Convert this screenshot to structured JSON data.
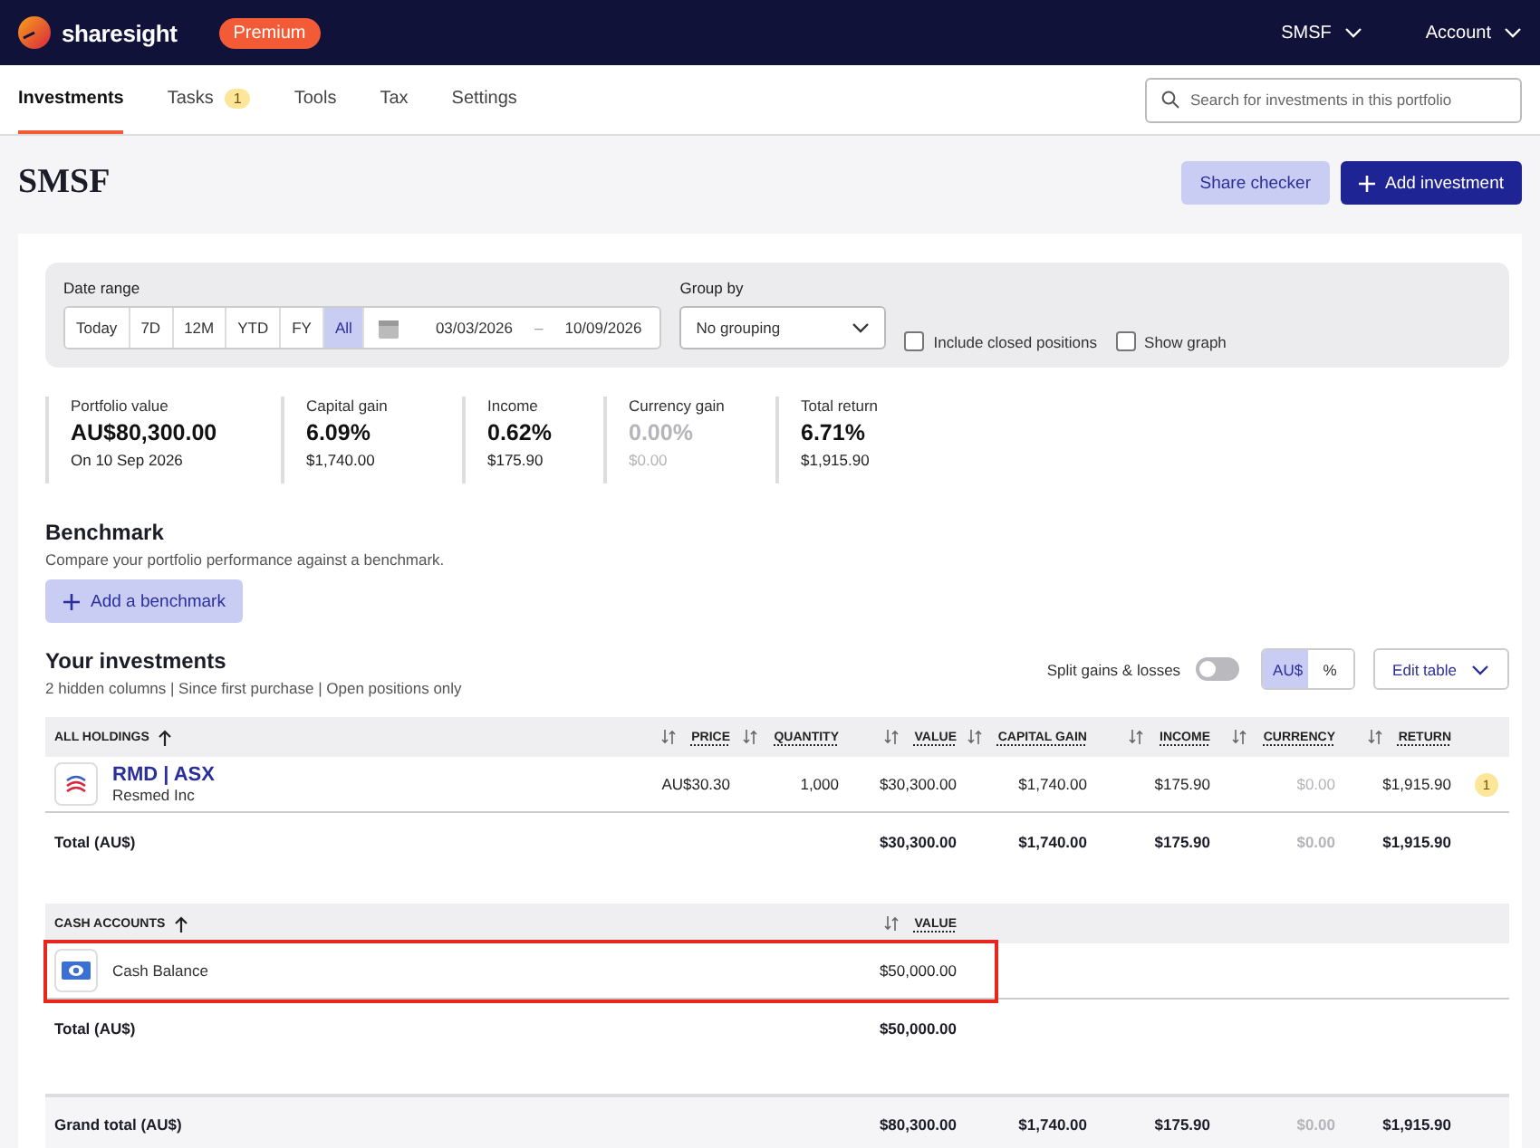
{
  "header": {
    "brand": "sharesight",
    "plan": "Premium",
    "menus": [
      {
        "label": "SMSF"
      },
      {
        "label": "Account"
      }
    ]
  },
  "tabs": [
    {
      "label": "Investments",
      "selected": true
    },
    {
      "label": "Tasks",
      "selected": false,
      "badge": "1"
    },
    {
      "label": "Tools",
      "selected": false
    },
    {
      "label": "Tax",
      "selected": false
    },
    {
      "label": "Settings",
      "selected": false
    }
  ],
  "search": {
    "placeholder": "Search for investments in this portfolio"
  },
  "portfolio": {
    "title": "SMSF",
    "buttons": [
      {
        "label": "Share checker",
        "kind": "secondary"
      },
      {
        "label": "Add investment",
        "kind": "primary"
      }
    ]
  },
  "filters": {
    "date_range_label": "Date range",
    "periods": [
      {
        "label": "Today",
        "selected": false
      },
      {
        "label": "7D",
        "selected": false
      },
      {
        "label": "12M",
        "selected": false
      },
      {
        "label": "YTD",
        "selected": false
      },
      {
        "label": "FY",
        "selected": false
      },
      {
        "label": "All",
        "selected": true
      }
    ],
    "start_date": "03/03/2026",
    "separator": "–",
    "end_date": "10/09/2026",
    "group_by_label": "Group by",
    "group_by": "No grouping",
    "checkboxes": [
      {
        "label": "Include closed positions",
        "checked": false
      },
      {
        "label": "Show graph",
        "checked": false
      }
    ]
  },
  "summary": [
    {
      "label": "Portfolio value",
      "value": "AU$80,300.00",
      "detail": "On 10 Sep 2026",
      "muted": false
    },
    {
      "label": "Capital gain",
      "value": "6.09%",
      "detail": "$1,740.00",
      "muted": false
    },
    {
      "label": "Income",
      "value": "0.62%",
      "detail": "$175.90",
      "muted": false
    },
    {
      "label": "Currency gain",
      "value": "0.00%",
      "detail": "$0.00",
      "muted": true
    },
    {
      "label": "Total return",
      "value": "6.71%",
      "detail": "$1,915.90",
      "muted": false
    }
  ],
  "benchmark": {
    "title": "Benchmark",
    "description": "Compare your portfolio performance against a benchmark.",
    "button": "Add a benchmark"
  },
  "investments": {
    "title": "Your investments",
    "subtitle": "2 hidden columns | Since first purchase | Open positions only",
    "split_label": "Split gains & losses",
    "split_on": false,
    "units": [
      {
        "label": "AU$",
        "selected": true
      },
      {
        "label": "%",
        "selected": false
      }
    ],
    "edit_button": "Edit table"
  },
  "holdings": {
    "columns": [
      {
        "label": "ALL HOLDINGS",
        "sorted": true
      },
      {
        "label": "PRICE",
        "sorted": false
      },
      {
        "label": "QUANTITY",
        "sorted": false
      },
      {
        "label": "VALUE",
        "sorted": false
      },
      {
        "label": "CAPITAL GAIN",
        "sorted": false
      },
      {
        "label": "INCOME",
        "sorted": false
      },
      {
        "label": "CURRENCY",
        "sorted": false,
        "muted": true
      },
      {
        "label": "RETURN",
        "sorted": false
      }
    ],
    "rows": [
      {
        "kind": "share",
        "subtitle": "Resmed Inc",
        "highlighted": false,
        "badge": "1",
        "cells": [
          "RMD | ASX",
          "AU$30.30",
          "1,000",
          "$30,300.00",
          "$1,740.00",
          "$175.90",
          "$0.00",
          "$1,915.90"
        ]
      }
    ],
    "total": {
      "cells": [
        "Total (AU$)",
        "",
        "",
        "$30,300.00",
        "$1,740.00",
        "$175.90",
        "$0.00",
        "$1,915.90"
      ]
    }
  },
  "cash": {
    "columns": [
      {
        "label": "CASH ACCOUNTS",
        "sorted": true
      },
      {
        "label": "VALUE",
        "sorted": false
      }
    ],
    "rows": [
      {
        "kind": "cash",
        "highlighted": true,
        "cells": [
          "Cash Balance",
          "$50,000.00"
        ]
      }
    ],
    "total": {
      "cells": [
        "Total (AU$)",
        "$50,000.00"
      ]
    }
  },
  "grand_total": {
    "cells": [
      "Grand total (AU$)",
      "",
      "",
      "$80,300.00",
      "$1,740.00",
      "$175.90",
      "$0.00",
      "$1,915.90"
    ]
  }
}
